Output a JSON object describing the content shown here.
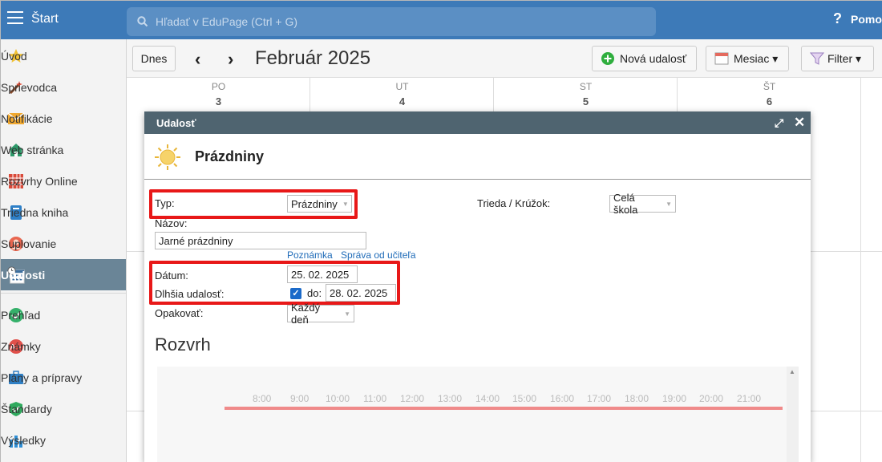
{
  "header": {
    "app_label": "Štart",
    "search_placeholder": "Hľadať v EduPage (Ctrl + G)",
    "help_label": "Pomoc"
  },
  "sidebar": {
    "items": [
      {
        "label": "Úvod",
        "icon": "star-icon"
      },
      {
        "label": "Sprievodca",
        "icon": "magic-wand-icon"
      },
      {
        "label": "Notifikácie",
        "icon": "envelope-icon"
      },
      {
        "label": "Web stránka",
        "icon": "house-icon"
      },
      {
        "label": "Rozvrhy Online",
        "icon": "timetable-icon"
      },
      {
        "label": "Triedna kniha",
        "icon": "book-icon"
      },
      {
        "label": "Suplovanie",
        "icon": "person-icon"
      },
      {
        "label": "Udalosti",
        "icon": "calendar-clock-icon",
        "active": true
      },
      {
        "label": "Prehľad",
        "icon": "check-circle-icon"
      },
      {
        "label": "Známky",
        "icon": "grade-icon"
      },
      {
        "label": "Plány a prípravy",
        "icon": "briefcase-icon"
      },
      {
        "label": "Štandardy",
        "icon": "shield-check-icon"
      },
      {
        "label": "Výsledky",
        "icon": "bar-chart-icon"
      }
    ]
  },
  "toolbar": {
    "today_label": "Dnes",
    "month_title": "Február 2025",
    "new_event_label": "Nová udalosť",
    "view_label": "Mesiac ▾",
    "filter_label": "Filter ▾"
  },
  "calendar": {
    "days": [
      {
        "name": "PO",
        "num": "3"
      },
      {
        "name": "UT",
        "num": "4"
      },
      {
        "name": "ST",
        "num": "5"
      },
      {
        "name": "ŠT",
        "num": "6"
      }
    ]
  },
  "dialog": {
    "title": "Udalosť",
    "event_title": "Prázdniny",
    "type_label": "Typ:",
    "type_value": "Prázdniny",
    "class_label": "Trieda / Krúžok:",
    "class_value": "Celá škola",
    "name_label": "Názov:",
    "name_value": "Jarné prázdniny",
    "note_link": "Poznámka",
    "teacher_msg_link": "Správa od učiteľa",
    "date_label": "Dátum:",
    "date_value": "25. 02. 2025",
    "longer_label": "Dlhšia udalosť:",
    "longer_checked": true,
    "to_label": "do:",
    "to_value": "28. 02. 2025",
    "repeat_label": "Opakovať:",
    "repeat_value": "Každý deň",
    "schedule_title": "Rozvrh",
    "hours": [
      "8:00",
      "9:00",
      "10:00",
      "11:00",
      "12:00",
      "13:00",
      "14:00",
      "15:00",
      "16:00",
      "17:00",
      "18:00",
      "19:00",
      "20:00",
      "21:00"
    ]
  },
  "colors": {
    "topbar": "#3d7ab8",
    "dialog_header": "#4f6470",
    "highlight": "#e81818",
    "sidebar_active": "#6a8597"
  }
}
